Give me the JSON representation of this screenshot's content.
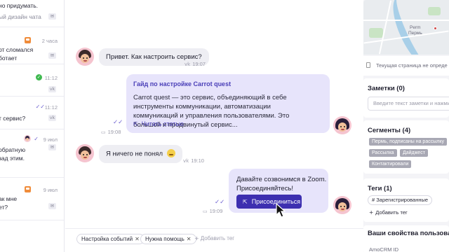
{
  "conversations": [
    {
      "line1": "но придумать.",
      "line2": "ый дизайн чата"
    },
    {
      "line1": "рт сломался",
      "line2": "ботает",
      "time": "2 часа"
    },
    {
      "time": "11:12"
    },
    {
      "line1": "т сервис?",
      "time": "11:12"
    },
    {
      "line1": "обратную",
      "line2": "зад этим.",
      "time": "9 июл"
    },
    {
      "line1": "ак мне",
      "line2": "ет?",
      "time": "9 июл"
    }
  ],
  "chat": {
    "msg1": {
      "text": "Привет. Как настроить сервис?",
      "time": "19:07"
    },
    "article": {
      "title": "Гайд по настройке Carrot quest",
      "body": "Carrot quest — это сервис, объединяющий в себе инструменты коммуникации, автоматизации коммуникаций и управления пользователями. Это большой и продвинутый сервис...",
      "link": "Читать статью",
      "time": "19:08"
    },
    "msg2": {
      "text": "Я ничего не понял",
      "time": "19:10"
    },
    "zoom": {
      "line1": "Давайте созвонимся в Zoom.",
      "line2": "Присоединяйтесь!",
      "button": "Присоединиться",
      "time": "19:09"
    },
    "tags": [
      "Настройка событий",
      "Нужна помощь"
    ],
    "add_tag": "Добавить тег"
  },
  "right": {
    "map": {
      "label1": "Perm",
      "label2": "Пермь"
    },
    "page_info": "Текущая страница не опреде",
    "notes": {
      "title": "Заметки (0)",
      "placeholder": "Введите текст заметки и нажмите"
    },
    "segments": {
      "title": "Сегменты (4)",
      "items": [
        "Пермь, подписаны на рассылку",
        "Рассылка",
        "Дайджест",
        "Контактировали"
      ]
    },
    "tags": {
      "title": "Теги (1)",
      "items": [
        "Зарегистрированные"
      ],
      "add": "Добавить тег"
    },
    "props": {
      "title": "Ваши свойства пользовате",
      "first": "AmoCRM ID"
    }
  }
}
